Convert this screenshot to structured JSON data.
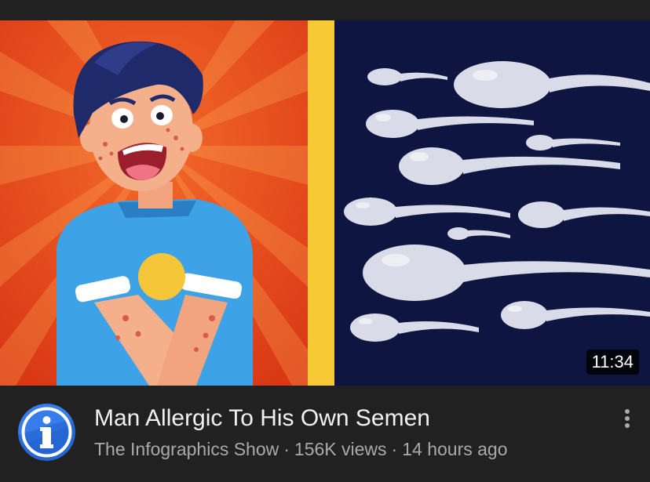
{
  "video": {
    "title": "Man Allergic To His Own Semen",
    "duration": "11:34",
    "channel": "The Infographics Show",
    "views": "156K views",
    "age": "14 hours ago",
    "separator": "·"
  },
  "avatar": {
    "letter": "i",
    "icon": "info-icon"
  },
  "menu": {
    "icon": "more-vertical-icon"
  },
  "colors": {
    "background": "#212121",
    "title_text": "#f1f1f1",
    "secondary_text": "#aaaaaa",
    "thumb_left_bg": "#e8461b",
    "thumb_divider": "#f7c934",
    "thumb_right_bg": "#0e1540",
    "sperm_color": "#d9dbe8",
    "avatar_blue": "#2a6fe0"
  }
}
